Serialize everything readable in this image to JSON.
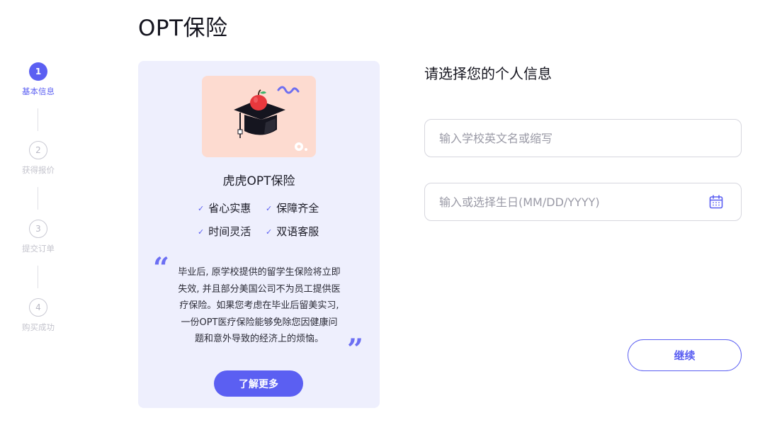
{
  "page": {
    "title": "OPT保险"
  },
  "stepper": {
    "steps": [
      {
        "number": "1",
        "label": "基本信息",
        "state": "active"
      },
      {
        "number": "2",
        "label": "获得报价",
        "state": "inactive"
      },
      {
        "number": "3",
        "label": "提交订单",
        "state": "inactive"
      },
      {
        "number": "4",
        "label": "购买成功",
        "state": "inactive"
      }
    ]
  },
  "promo": {
    "image_icon": "graduation-cap-apple-illustration",
    "product_name": "虎虎OPT保险",
    "features": [
      "省心实惠",
      "保障齐全",
      "时间灵活",
      "双语客服"
    ],
    "check_icon": "check-icon",
    "quote_open": "“",
    "quote_close": "”",
    "description_lines": [
      "毕业后, 原学校提供的留学生保险将立即",
      "失效, 并且部分美国公司不为员工提供医",
      "疗保险。如果您考虑在毕业后留美实习,",
      "一份OPT医疗保险能够免除您因健康问",
      "题和意外导致的经济上的烦恼。"
    ],
    "button_label": "了解更多"
  },
  "form": {
    "title": "请选择您的个人信息",
    "school_input": {
      "value": "",
      "placeholder": "输入学校英文名或缩写"
    },
    "birthday_input": {
      "value": "",
      "placeholder": "输入或选择生日(MM/DD/YYYY)",
      "icon": "calendar-icon"
    },
    "continue_label": "继续"
  },
  "colors": {
    "accent": "#5b5ff2",
    "card_background": "#eeeffd",
    "image_background": "#fddbd0",
    "border": "#d6d6de",
    "inactive_step": "#c4c4cd"
  }
}
